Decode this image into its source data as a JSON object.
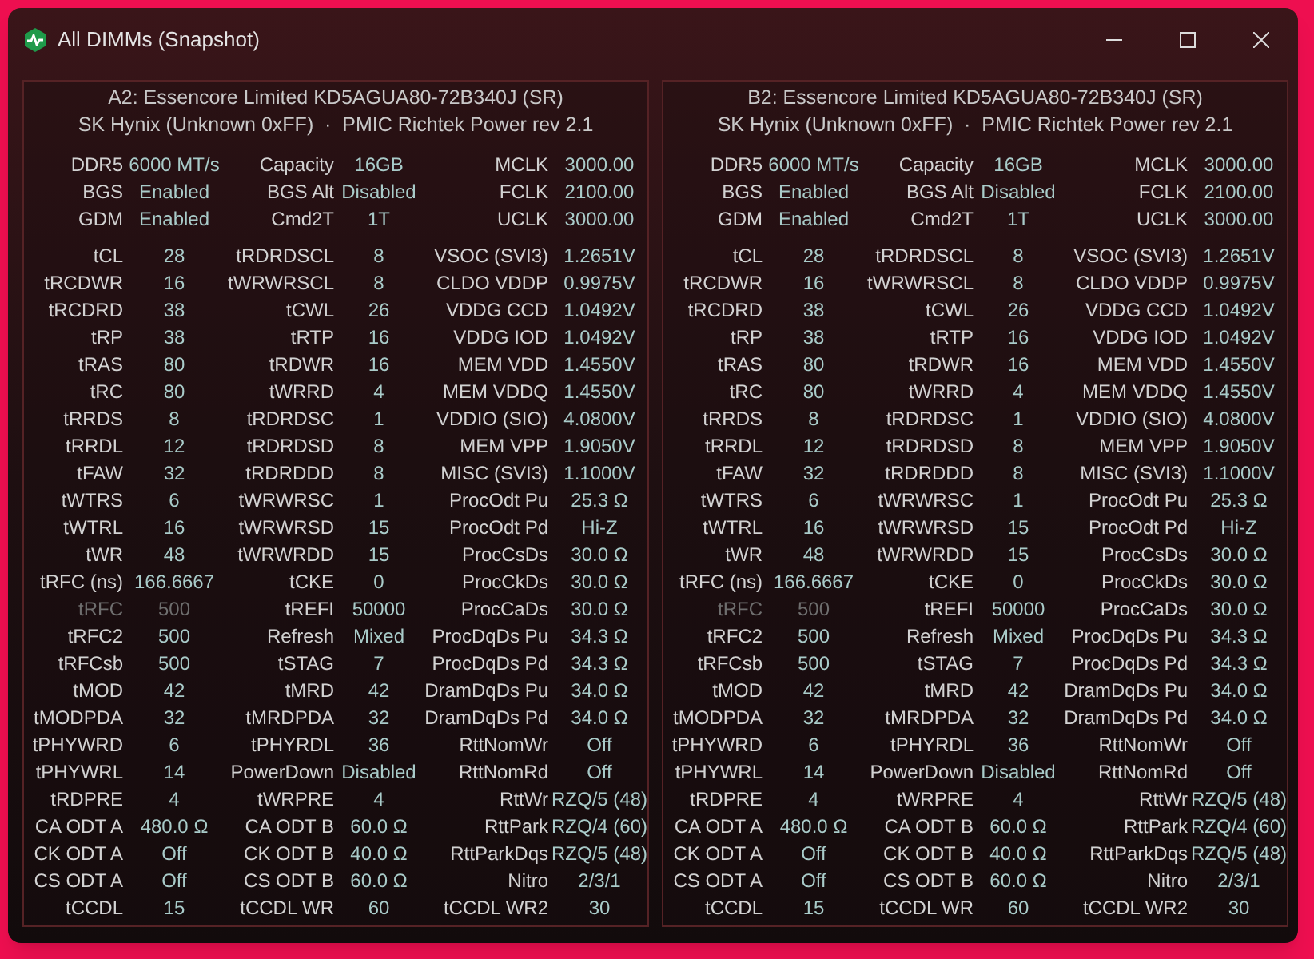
{
  "window": {
    "title": "All DIMMs (Snapshot)"
  },
  "panels": [
    {
      "header": [
        "A2: Essencore Limited KD5AGUA80-72B340J (SR)",
        "SK Hynix (Unknown 0xFF)  ·  PMIC Richtek Power rev 2.1"
      ],
      "summary": [
        {
          "cells": [
            {
              "label": "DDR5",
              "value": "6000 MT/s",
              "disabled": false
            },
            {
              "label": "Capacity",
              "value": "16GB",
              "disabled": false
            },
            {
              "label": "MCLK",
              "value": "3000.00",
              "disabled": false
            }
          ]
        },
        {
          "cells": [
            {
              "label": "BGS",
              "value": "Enabled",
              "disabled": false
            },
            {
              "label": "BGS Alt",
              "value": "Disabled",
              "disabled": false
            },
            {
              "label": "FCLK",
              "value": "2100.00",
              "disabled": false
            }
          ]
        },
        {
          "cells": [
            {
              "label": "GDM",
              "value": "Enabled",
              "disabled": false
            },
            {
              "label": "Cmd2T",
              "value": "1T",
              "disabled": false
            },
            {
              "label": "UCLK",
              "value": "3000.00",
              "disabled": false
            }
          ]
        }
      ],
      "timings": [
        {
          "cells": [
            {
              "label": "tCL",
              "value": "28",
              "disabled": false
            },
            {
              "label": "tRDRDSCL",
              "value": "8",
              "disabled": false
            },
            {
              "label": "VSOC (SVI3)",
              "value": "1.2651V",
              "disabled": false
            }
          ]
        },
        {
          "cells": [
            {
              "label": "tRCDWR",
              "value": "16",
              "disabled": false
            },
            {
              "label": "tWRWRSCL",
              "value": "8",
              "disabled": false
            },
            {
              "label": "CLDO VDDP",
              "value": "0.9975V",
              "disabled": false
            }
          ]
        },
        {
          "cells": [
            {
              "label": "tRCDRD",
              "value": "38",
              "disabled": false
            },
            {
              "label": "tCWL",
              "value": "26",
              "disabled": false
            },
            {
              "label": "VDDG CCD",
              "value": "1.0492V",
              "disabled": false
            }
          ]
        },
        {
          "cells": [
            {
              "label": "tRP",
              "value": "38",
              "disabled": false
            },
            {
              "label": "tRTP",
              "value": "16",
              "disabled": false
            },
            {
              "label": "VDDG IOD",
              "value": "1.0492V",
              "disabled": false
            }
          ]
        },
        {
          "cells": [
            {
              "label": "tRAS",
              "value": "80",
              "disabled": false
            },
            {
              "label": "tRDWR",
              "value": "16",
              "disabled": false
            },
            {
              "label": "MEM VDD",
              "value": "1.4550V",
              "disabled": false
            }
          ]
        },
        {
          "cells": [
            {
              "label": "tRC",
              "value": "80",
              "disabled": false
            },
            {
              "label": "tWRRD",
              "value": "4",
              "disabled": false
            },
            {
              "label": "MEM VDDQ",
              "value": "1.4550V",
              "disabled": false
            }
          ]
        },
        {
          "cells": [
            {
              "label": "tRRDS",
              "value": "8",
              "disabled": false
            },
            {
              "label": "tRDRDSC",
              "value": "1",
              "disabled": false
            },
            {
              "label": "VDDIO (SIO)",
              "value": "4.0800V",
              "disabled": false
            }
          ]
        },
        {
          "cells": [
            {
              "label": "tRRDL",
              "value": "12",
              "disabled": false
            },
            {
              "label": "tRDRDSD",
              "value": "8",
              "disabled": false
            },
            {
              "label": "MEM VPP",
              "value": "1.9050V",
              "disabled": false
            }
          ]
        },
        {
          "cells": [
            {
              "label": "tFAW",
              "value": "32",
              "disabled": false
            },
            {
              "label": "tRDRDDD",
              "value": "8",
              "disabled": false
            },
            {
              "label": "MISC (SVI3)",
              "value": "1.1000V",
              "disabled": false
            }
          ]
        },
        {
          "cells": [
            {
              "label": "tWTRS",
              "value": "6",
              "disabled": false
            },
            {
              "label": "tWRWRSC",
              "value": "1",
              "disabled": false
            },
            {
              "label": "ProcOdt Pu",
              "value": "25.3 Ω",
              "disabled": false
            }
          ]
        },
        {
          "cells": [
            {
              "label": "tWTRL",
              "value": "16",
              "disabled": false
            },
            {
              "label": "tWRWRSD",
              "value": "15",
              "disabled": false
            },
            {
              "label": "ProcOdt Pd",
              "value": "Hi-Z",
              "disabled": false
            }
          ]
        },
        {
          "cells": [
            {
              "label": "tWR",
              "value": "48",
              "disabled": false
            },
            {
              "label": "tWRWRDD",
              "value": "15",
              "disabled": false
            },
            {
              "label": "ProcCsDs",
              "value": "30.0 Ω",
              "disabled": false
            }
          ]
        },
        {
          "cells": [
            {
              "label": "tRFC (ns)",
              "value": "166.6667",
              "disabled": false
            },
            {
              "label": "tCKE",
              "value": "0",
              "disabled": false
            },
            {
              "label": "ProcCkDs",
              "value": "30.0 Ω",
              "disabled": false
            }
          ]
        },
        {
          "cells": [
            {
              "label": "tRFC",
              "value": "500",
              "disabled": true
            },
            {
              "label": "tREFI",
              "value": "50000",
              "disabled": false
            },
            {
              "label": "ProcCaDs",
              "value": "30.0 Ω",
              "disabled": false
            }
          ]
        },
        {
          "cells": [
            {
              "label": "tRFC2",
              "value": "500",
              "disabled": false
            },
            {
              "label": "Refresh",
              "value": "Mixed",
              "disabled": false
            },
            {
              "label": "ProcDqDs Pu",
              "value": "34.3 Ω",
              "disabled": false
            }
          ]
        },
        {
          "cells": [
            {
              "label": "tRFCsb",
              "value": "500",
              "disabled": false
            },
            {
              "label": "tSTAG",
              "value": "7",
              "disabled": false
            },
            {
              "label": "ProcDqDs Pd",
              "value": "34.3 Ω",
              "disabled": false
            }
          ]
        },
        {
          "cells": [
            {
              "label": "tMOD",
              "value": "42",
              "disabled": false
            },
            {
              "label": "tMRD",
              "value": "42",
              "disabled": false
            },
            {
              "label": "DramDqDs Pu",
              "value": "34.0 Ω",
              "disabled": false
            }
          ]
        },
        {
          "cells": [
            {
              "label": "tMODPDA",
              "value": "32",
              "disabled": false
            },
            {
              "label": "tMRDPDA",
              "value": "32",
              "disabled": false
            },
            {
              "label": "DramDqDs Pd",
              "value": "34.0 Ω",
              "disabled": false
            }
          ]
        },
        {
          "cells": [
            {
              "label": "tPHYWRD",
              "value": "6",
              "disabled": false
            },
            {
              "label": "tPHYRDL",
              "value": "36",
              "disabled": false
            },
            {
              "label": "RttNomWr",
              "value": "Off",
              "disabled": false
            }
          ]
        },
        {
          "cells": [
            {
              "label": "tPHYWRL",
              "value": "14",
              "disabled": false
            },
            {
              "label": "PowerDown",
              "value": "Disabled",
              "disabled": false
            },
            {
              "label": "RttNomRd",
              "value": "Off",
              "disabled": false
            }
          ]
        },
        {
          "cells": [
            {
              "label": "tRDPRE",
              "value": "4",
              "disabled": false
            },
            {
              "label": "tWRPRE",
              "value": "4",
              "disabled": false
            },
            {
              "label": "RttWr",
              "value": "RZQ/5 (48)",
              "disabled": false
            }
          ]
        },
        {
          "cells": [
            {
              "label": "CA ODT A",
              "value": "480.0 Ω",
              "disabled": false
            },
            {
              "label": "CA ODT B",
              "value": "60.0 Ω",
              "disabled": false
            },
            {
              "label": "RttPark",
              "value": "RZQ/4 (60)",
              "disabled": false
            }
          ]
        },
        {
          "cells": [
            {
              "label": "CK ODT A",
              "value": "Off",
              "disabled": false
            },
            {
              "label": "CK ODT B",
              "value": "40.0 Ω",
              "disabled": false
            },
            {
              "label": "RttParkDqs",
              "value": "RZQ/5 (48)",
              "disabled": false
            }
          ]
        },
        {
          "cells": [
            {
              "label": "CS ODT A",
              "value": "Off",
              "disabled": false
            },
            {
              "label": "CS ODT B",
              "value": "60.0 Ω",
              "disabled": false
            },
            {
              "label": "Nitro",
              "value": "2/3/1",
              "disabled": false
            }
          ]
        },
        {
          "cells": [
            {
              "label": "tCCDL",
              "value": "15",
              "disabled": false
            },
            {
              "label": "tCCDL WR",
              "value": "60",
              "disabled": false
            },
            {
              "label": "tCCDL WR2",
              "value": "30",
              "disabled": false
            }
          ]
        }
      ]
    },
    {
      "header": [
        "B2: Essencore Limited KD5AGUA80-72B340J (SR)",
        "SK Hynix (Unknown 0xFF)  ·  PMIC Richtek Power rev 2.1"
      ],
      "summary": [
        {
          "cells": [
            {
              "label": "DDR5",
              "value": "6000 MT/s",
              "disabled": false
            },
            {
              "label": "Capacity",
              "value": "16GB",
              "disabled": false
            },
            {
              "label": "MCLK",
              "value": "3000.00",
              "disabled": false
            }
          ]
        },
        {
          "cells": [
            {
              "label": "BGS",
              "value": "Enabled",
              "disabled": false
            },
            {
              "label": "BGS Alt",
              "value": "Disabled",
              "disabled": false
            },
            {
              "label": "FCLK",
              "value": "2100.00",
              "disabled": false
            }
          ]
        },
        {
          "cells": [
            {
              "label": "GDM",
              "value": "Enabled",
              "disabled": false
            },
            {
              "label": "Cmd2T",
              "value": "1T",
              "disabled": false
            },
            {
              "label": "UCLK",
              "value": "3000.00",
              "disabled": false
            }
          ]
        }
      ],
      "timings": [
        {
          "cells": [
            {
              "label": "tCL",
              "value": "28",
              "disabled": false
            },
            {
              "label": "tRDRDSCL",
              "value": "8",
              "disabled": false
            },
            {
              "label": "VSOC (SVI3)",
              "value": "1.2651V",
              "disabled": false
            }
          ]
        },
        {
          "cells": [
            {
              "label": "tRCDWR",
              "value": "16",
              "disabled": false
            },
            {
              "label": "tWRWRSCL",
              "value": "8",
              "disabled": false
            },
            {
              "label": "CLDO VDDP",
              "value": "0.9975V",
              "disabled": false
            }
          ]
        },
        {
          "cells": [
            {
              "label": "tRCDRD",
              "value": "38",
              "disabled": false
            },
            {
              "label": "tCWL",
              "value": "26",
              "disabled": false
            },
            {
              "label": "VDDG CCD",
              "value": "1.0492V",
              "disabled": false
            }
          ]
        },
        {
          "cells": [
            {
              "label": "tRP",
              "value": "38",
              "disabled": false
            },
            {
              "label": "tRTP",
              "value": "16",
              "disabled": false
            },
            {
              "label": "VDDG IOD",
              "value": "1.0492V",
              "disabled": false
            }
          ]
        },
        {
          "cells": [
            {
              "label": "tRAS",
              "value": "80",
              "disabled": false
            },
            {
              "label": "tRDWR",
              "value": "16",
              "disabled": false
            },
            {
              "label": "MEM VDD",
              "value": "1.4550V",
              "disabled": false
            }
          ]
        },
        {
          "cells": [
            {
              "label": "tRC",
              "value": "80",
              "disabled": false
            },
            {
              "label": "tWRRD",
              "value": "4",
              "disabled": false
            },
            {
              "label": "MEM VDDQ",
              "value": "1.4550V",
              "disabled": false
            }
          ]
        },
        {
          "cells": [
            {
              "label": "tRRDS",
              "value": "8",
              "disabled": false
            },
            {
              "label": "tRDRDSC",
              "value": "1",
              "disabled": false
            },
            {
              "label": "VDDIO (SIO)",
              "value": "4.0800V",
              "disabled": false
            }
          ]
        },
        {
          "cells": [
            {
              "label": "tRRDL",
              "value": "12",
              "disabled": false
            },
            {
              "label": "tRDRDSD",
              "value": "8",
              "disabled": false
            },
            {
              "label": "MEM VPP",
              "value": "1.9050V",
              "disabled": false
            }
          ]
        },
        {
          "cells": [
            {
              "label": "tFAW",
              "value": "32",
              "disabled": false
            },
            {
              "label": "tRDRDDD",
              "value": "8",
              "disabled": false
            },
            {
              "label": "MISC (SVI3)",
              "value": "1.1000V",
              "disabled": false
            }
          ]
        },
        {
          "cells": [
            {
              "label": "tWTRS",
              "value": "6",
              "disabled": false
            },
            {
              "label": "tWRWRSC",
              "value": "1",
              "disabled": false
            },
            {
              "label": "ProcOdt Pu",
              "value": "25.3 Ω",
              "disabled": false
            }
          ]
        },
        {
          "cells": [
            {
              "label": "tWTRL",
              "value": "16",
              "disabled": false
            },
            {
              "label": "tWRWRSD",
              "value": "15",
              "disabled": false
            },
            {
              "label": "ProcOdt Pd",
              "value": "Hi-Z",
              "disabled": false
            }
          ]
        },
        {
          "cells": [
            {
              "label": "tWR",
              "value": "48",
              "disabled": false
            },
            {
              "label": "tWRWRDD",
              "value": "15",
              "disabled": false
            },
            {
              "label": "ProcCsDs",
              "value": "30.0 Ω",
              "disabled": false
            }
          ]
        },
        {
          "cells": [
            {
              "label": "tRFC (ns)",
              "value": "166.6667",
              "disabled": false
            },
            {
              "label": "tCKE",
              "value": "0",
              "disabled": false
            },
            {
              "label": "ProcCkDs",
              "value": "30.0 Ω",
              "disabled": false
            }
          ]
        },
        {
          "cells": [
            {
              "label": "tRFC",
              "value": "500",
              "disabled": true
            },
            {
              "label": "tREFI",
              "value": "50000",
              "disabled": false
            },
            {
              "label": "ProcCaDs",
              "value": "30.0 Ω",
              "disabled": false
            }
          ]
        },
        {
          "cells": [
            {
              "label": "tRFC2",
              "value": "500",
              "disabled": false
            },
            {
              "label": "Refresh",
              "value": "Mixed",
              "disabled": false
            },
            {
              "label": "ProcDqDs Pu",
              "value": "34.3 Ω",
              "disabled": false
            }
          ]
        },
        {
          "cells": [
            {
              "label": "tRFCsb",
              "value": "500",
              "disabled": false
            },
            {
              "label": "tSTAG",
              "value": "7",
              "disabled": false
            },
            {
              "label": "ProcDqDs Pd",
              "value": "34.3 Ω",
              "disabled": false
            }
          ]
        },
        {
          "cells": [
            {
              "label": "tMOD",
              "value": "42",
              "disabled": false
            },
            {
              "label": "tMRD",
              "value": "42",
              "disabled": false
            },
            {
              "label": "DramDqDs Pu",
              "value": "34.0 Ω",
              "disabled": false
            }
          ]
        },
        {
          "cells": [
            {
              "label": "tMODPDA",
              "value": "32",
              "disabled": false
            },
            {
              "label": "tMRDPDA",
              "value": "32",
              "disabled": false
            },
            {
              "label": "DramDqDs Pd",
              "value": "34.0 Ω",
              "disabled": false
            }
          ]
        },
        {
          "cells": [
            {
              "label": "tPHYWRD",
              "value": "6",
              "disabled": false
            },
            {
              "label": "tPHYRDL",
              "value": "36",
              "disabled": false
            },
            {
              "label": "RttNomWr",
              "value": "Off",
              "disabled": false
            }
          ]
        },
        {
          "cells": [
            {
              "label": "tPHYWRL",
              "value": "14",
              "disabled": false
            },
            {
              "label": "PowerDown",
              "value": "Disabled",
              "disabled": false
            },
            {
              "label": "RttNomRd",
              "value": "Off",
              "disabled": false
            }
          ]
        },
        {
          "cells": [
            {
              "label": "tRDPRE",
              "value": "4",
              "disabled": false
            },
            {
              "label": "tWRPRE",
              "value": "4",
              "disabled": false
            },
            {
              "label": "RttWr",
              "value": "RZQ/5 (48)",
              "disabled": false
            }
          ]
        },
        {
          "cells": [
            {
              "label": "CA ODT A",
              "value": "480.0 Ω",
              "disabled": false
            },
            {
              "label": "CA ODT B",
              "value": "60.0 Ω",
              "disabled": false
            },
            {
              "label": "RttPark",
              "value": "RZQ/4 (60)",
              "disabled": false
            }
          ]
        },
        {
          "cells": [
            {
              "label": "CK ODT A",
              "value": "Off",
              "disabled": false
            },
            {
              "label": "CK ODT B",
              "value": "40.0 Ω",
              "disabled": false
            },
            {
              "label": "RttParkDqs",
              "value": "RZQ/5 (48)",
              "disabled": false
            }
          ]
        },
        {
          "cells": [
            {
              "label": "CS ODT A",
              "value": "Off",
              "disabled": false
            },
            {
              "label": "CS ODT B",
              "value": "60.0 Ω",
              "disabled": false
            },
            {
              "label": "Nitro",
              "value": "2/3/1",
              "disabled": false
            }
          ]
        },
        {
          "cells": [
            {
              "label": "tCCDL",
              "value": "15",
              "disabled": false
            },
            {
              "label": "tCCDL WR",
              "value": "60",
              "disabled": false
            },
            {
              "label": "tCCDL WR2",
              "value": "30",
              "disabled": false
            }
          ]
        }
      ]
    }
  ]
}
